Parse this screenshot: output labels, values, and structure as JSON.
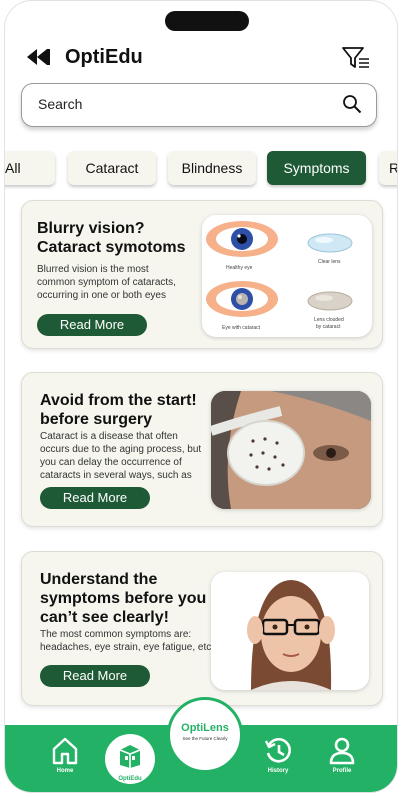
{
  "header": {
    "title": "OptiEdu",
    "back_icon": "back-arrow-icon",
    "filter_icon": "filter-icon"
  },
  "search": {
    "placeholder": "Search",
    "value": "",
    "icon": "search-icon"
  },
  "tabs": [
    {
      "label": "All",
      "active": false
    },
    {
      "label": "Cataract",
      "active": false
    },
    {
      "label": "Blindness",
      "active": false
    },
    {
      "label": "Symptoms",
      "active": true
    },
    {
      "label": "R",
      "active": false
    }
  ],
  "cards": [
    {
      "title_line1": "Blurry vision?",
      "title_line2": "Cataract symotoms",
      "desc_line1": "Blurred vision is the most",
      "desc_line2": "common symptom of cataracts,",
      "desc_line3": "occurring in one or both eyes",
      "button": "Read More",
      "image": {
        "label_healthy_eye": "Healthy eye",
        "label_clear_lens": "Clear lens",
        "label_eye_cataract": "Eye with cataract",
        "label_lens_clouded_1": "Lens clouded",
        "label_lens_clouded_2": "by cataract"
      }
    },
    {
      "title_line1": "Avoid from the start!",
      "title_line2": "before surgery",
      "desc_line1": "Cataract is a disease that often",
      "desc_line2": "occurs due to the aging process, but",
      "desc_line3": "you can delay the occurrence of",
      "desc_line4": "cataracts in several ways, such as",
      "button": "Read More"
    },
    {
      "title_line1": "Understand the",
      "title_line2": "symptoms before you",
      "title_line3": "can’t see clearly!",
      "desc_line1": "The most common symptoms are:",
      "desc_line2": "headaches, eye strain, eye fatigue, etc",
      "button": "Read More"
    }
  ],
  "bottom_nav": {
    "home": "Home",
    "optiedu": "OptiEdu",
    "history": "History",
    "profile": "Profile",
    "fab_title": "OptiLens",
    "fab_tagline": "See the Future Clearly"
  },
  "colors": {
    "primary": "#1f5a36",
    "nav_green": "#23b265",
    "card_bg": "#f6f6ef"
  }
}
